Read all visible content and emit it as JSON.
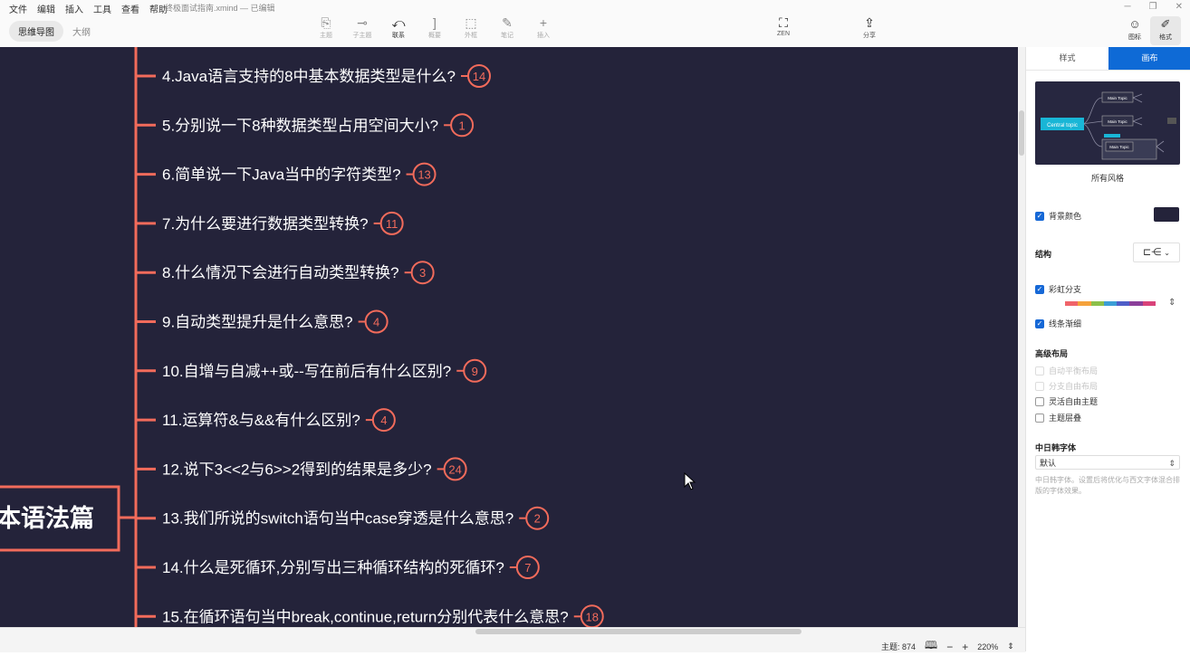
{
  "menu": [
    "文件",
    "编辑",
    "插入",
    "工具",
    "查看",
    "帮助"
  ],
  "file_title": "终极面试指南.xmind — 已编辑",
  "view_tabs": [
    "思维导图",
    "大纲"
  ],
  "toolbar": [
    {
      "label": "主题",
      "icon": "topic-icon"
    },
    {
      "label": "子主题",
      "icon": "subtopic-icon"
    },
    {
      "label": "联系",
      "icon": "relationship-icon"
    },
    {
      "label": "概要",
      "icon": "summary-icon"
    },
    {
      "label": "外框",
      "icon": "boundary-icon"
    },
    {
      "label": "笔记",
      "icon": "note-icon"
    },
    {
      "label": "插入",
      "icon": "plus-icon"
    }
  ],
  "zen_label": "ZEN",
  "share_label": "分享",
  "right_tools": [
    "图标",
    "格式"
  ],
  "central_topic": "本语法篇",
  "topics": [
    {
      "text": "4.Java语言支持的8中基本数据类型是什么?",
      "count": "14"
    },
    {
      "text": "5.分别说一下8种数据类型占用空间大小?",
      "count": "1"
    },
    {
      "text": "6.简单说一下Java当中的字符类型?",
      "count": "13"
    },
    {
      "text": "7.为什么要进行数据类型转换?",
      "count": "11"
    },
    {
      "text": "8.什么情况下会进行自动类型转换?",
      "count": "3"
    },
    {
      "text": "9.自动类型提升是什么意思?",
      "count": "4"
    },
    {
      "text": "10.自增与自减++或--写在前后有什么区别?",
      "count": "9"
    },
    {
      "text": "11.运算符&与&&有什么区别?",
      "count": "4"
    },
    {
      "text": "12.说下3<<2与6>>2得到的结果是多少?",
      "count": "24"
    },
    {
      "text": "13.我们所说的switch语句当中case穿透是什么意思?",
      "count": "2"
    },
    {
      "text": "14.什么是死循环,分别写出三种循环结构的死循环?",
      "count": "7"
    },
    {
      "text": "15.在循环语句当中break,continue,return分别代表什么意思?",
      "count": "18"
    }
  ],
  "colors": {
    "canvas": "#24233a",
    "branch": "#f26b5b",
    "accent": "#0e6ad6"
  },
  "status": {
    "topic_count": "主题: 874",
    "zoom": "220%"
  },
  "panel": {
    "tabs": [
      "样式",
      "画布"
    ],
    "thumb": {
      "central": "Central topic",
      "main": "Main Topic"
    },
    "all_styles": "所有风格",
    "bg_color": "背景颜色",
    "structure": "结构",
    "rainbow": "彩虹分支",
    "thin_lines": "线条渐细",
    "advanced": "高级布局",
    "adv_items": [
      "自动平衡布局",
      "分支自由布局",
      "灵活自由主题",
      "主题层叠"
    ],
    "cjk_font": "中日韩字体",
    "font_value": "默认",
    "font_note": "中日韩字体。设置后将优化与西文字体混合排版的字体效果。"
  }
}
